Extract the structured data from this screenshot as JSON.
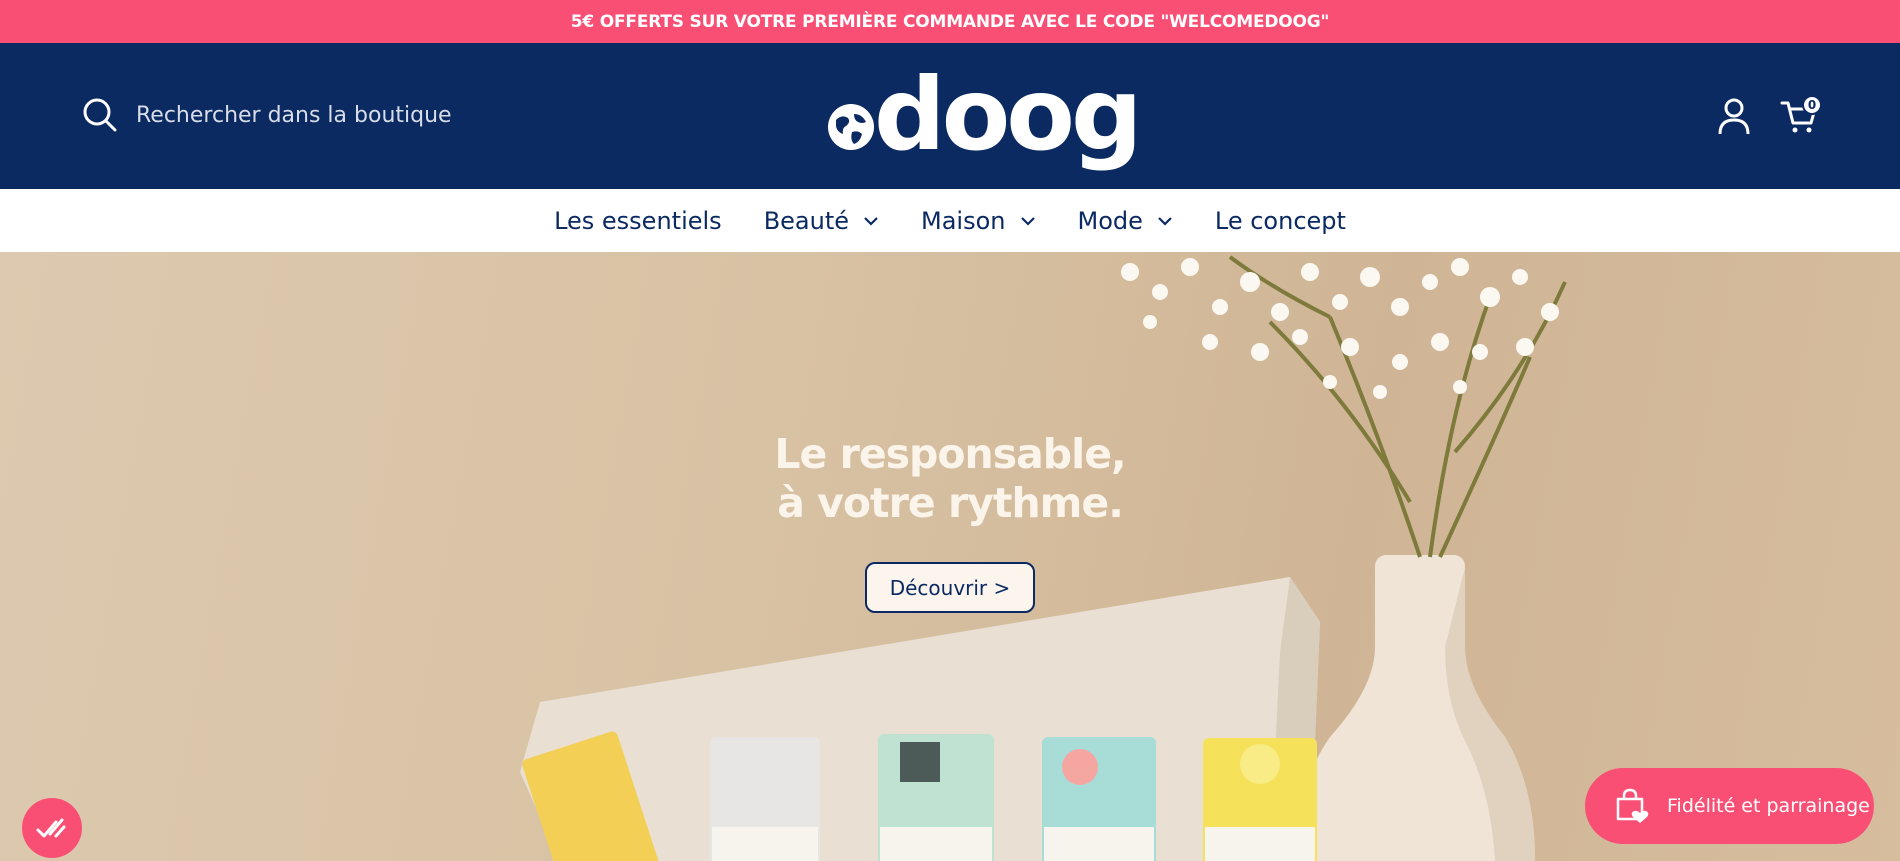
{
  "announcement": {
    "text": "5€ OFFERTS SUR VOTRE PREMIÈRE COMMANDE AVEC LE CODE \"WELCOMEDOOG\""
  },
  "header": {
    "search_placeholder": "Rechercher dans la boutique",
    "logo_text": "doog",
    "cart_count": "0"
  },
  "nav": {
    "items": [
      {
        "label": "Les essentiels",
        "has_dropdown": false
      },
      {
        "label": "Beauté",
        "has_dropdown": true
      },
      {
        "label": "Maison",
        "has_dropdown": true
      },
      {
        "label": "Mode",
        "has_dropdown": true
      },
      {
        "label": "Le concept",
        "has_dropdown": false
      }
    ]
  },
  "hero": {
    "headline_line1": "Le responsable,",
    "headline_line2": "à votre rythme.",
    "cta_label": "Découvrir >"
  },
  "widgets": {
    "loyalty_label": "Fidélité et parrainage",
    "accessibility_icon": "accessibility-check-icon"
  },
  "colors": {
    "brand_navy": "#0b2a62",
    "brand_pink": "#f94f74",
    "hero_beige": "#d8c2a4"
  }
}
